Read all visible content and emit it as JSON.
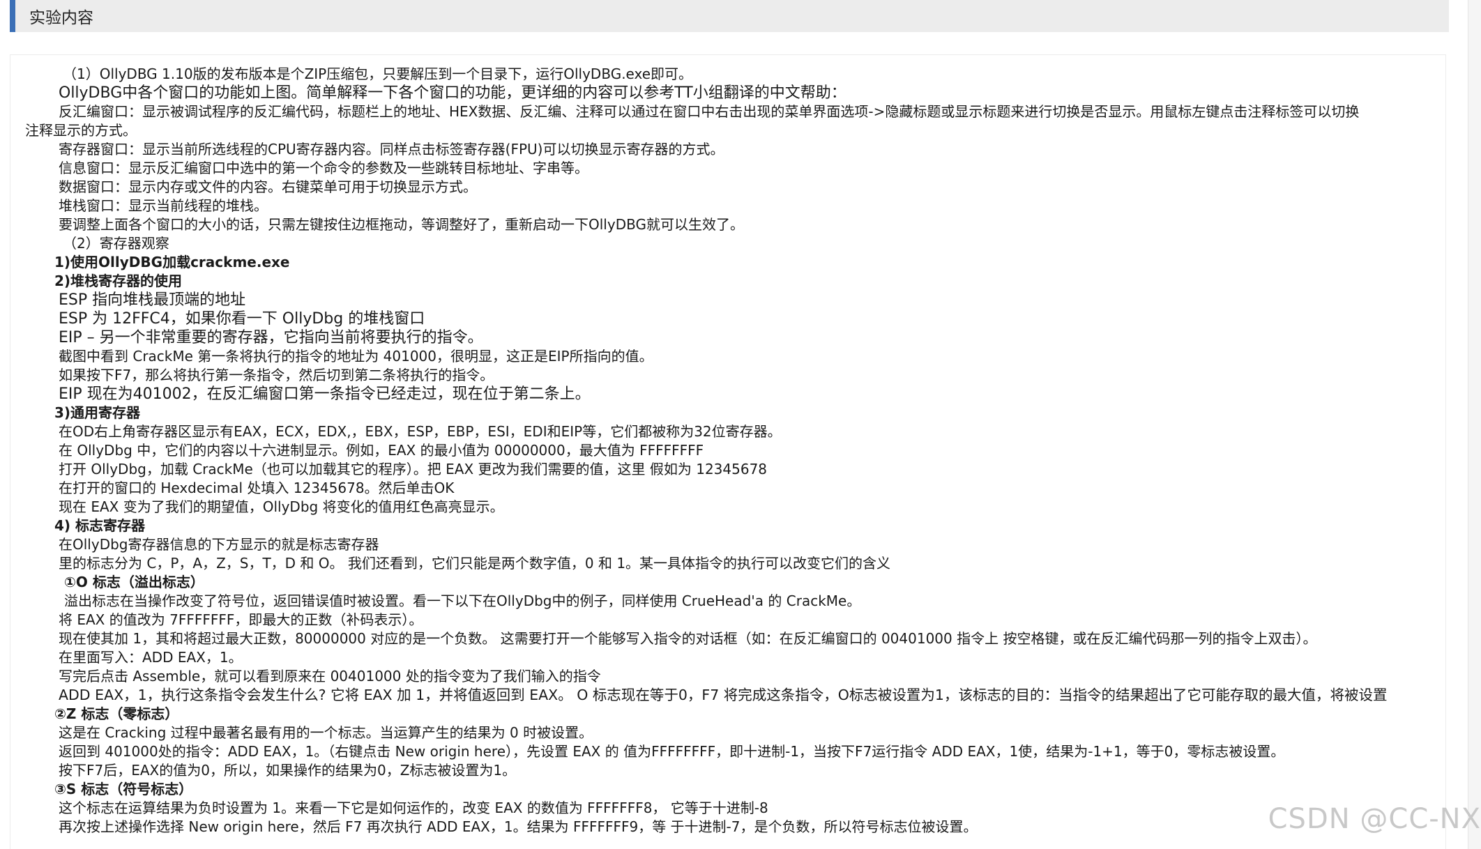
{
  "header": {
    "title": "实验内容"
  },
  "lines": [
    "（1）OllyDBG 1.10版的发布版本是个ZIP压缩包，只要解压到一个目录下，运行OllyDBG.exe即可。",
    "OllyDBG中各个窗口的功能如上图。简单解释一下各个窗口的功能，更详细的内容可以参考TT小组翻译的中文帮助：",
    "反汇编窗口：显示被调试程序的反汇编代码，标题栏上的地址、HEX数据、反汇编、注释可以通过在窗口中右击出现的菜单界面选项->隐藏标题或显示标题来进行切换是否显示。用鼠标左键点击注释标签可以切换",
    "注释显示的方式。",
    "寄存器窗口：显示当前所选线程的CPU寄存器内容。同样点击标签寄存器(FPU)可以切换显示寄存器的方式。",
    "信息窗口：显示反汇编窗口中选中的第一个命令的参数及一些跳转目标地址、字串等。",
    "数据窗口：显示内存或文件的内容。右键菜单可用于切换显示方式。",
    "堆栈窗口：显示当前线程的堆栈。",
    "要调整上面各个窗口的大小的话，只需左键按住边框拖动，等调整好了，重新启动一下OllyDBG就可以生效了。",
    "（2）寄存器观察",
    "1)使用OllyDBG加载crackme.exe",
    "2)堆栈寄存器的使用",
    "ESP 指向堆栈最顶端的地址",
    "ESP 为 12FFC4，如果你看一下 OllyDbg 的堆栈窗口",
    "EIP – 另一个非常重要的寄存器，它指向当前将要执行的指令。",
    "截图中看到 CrackMe 第一条将执行的指令的地址为 401000，很明显，这正是EIP所指向的值。",
    "如果按下F7，那么将执行第一条指令，然后切到第二条将执行的指令。",
    "EIP 现在为401002，在反汇编窗口第一条指令已经走过，现在位于第二条上。",
    "3)通用寄存器",
    "在OD右上角寄存器区显示有EAX，ECX，EDX,，EBX，ESP，EBP，ESI，EDI和EIP等，它们都被称为32位寄存器。",
    "在 OllyDbg 中，它们的内容以十六进制显示。例如，EAX 的最小值为 00000000，最大值为 FFFFFFFF",
    "打开 OllyDbg，加载 CrackMe（也可以加载其它的程序）。把 EAX 更改为我们需要的值，这里 假如为 12345678",
    "在打开的窗口的 Hexdecimal 处填入 12345678。然后单击OK",
    "现在 EAX 变为了我们的期望值，OllyDbg 将变化的值用红色高亮显示。",
    "4) 标志寄存器",
    "在OllyDbg寄存器信息的下方显示的就是标志寄存器",
    "里的标志分为 C，P，A，Z，S，T，D 和 O。 我们还看到，它们只能是两个数字值，0 和 1。某一具体指令的执行可以改变它们的含义",
    "①O 标志（溢出标志）",
    "溢出标志在当操作改变了符号位，返回错误值时被设置。看一下以下在OllyDbg中的例子，同样使用 CrueHead'a 的 CrackMe。",
    "将 EAX 的值改为 7FFFFFFF，即最大的正数（补码表示）。",
    "现在使其加 1，其和将超过最大正数，80000000 对应的是一个负数。 这需要打开一个能够写入指令的对话框（如：在反汇编窗口的 00401000 指令上 按空格键，或在反汇编代码那一列的指令上双击）。",
    "在里面写入：ADD EAX，1。",
    "写完后点击 Assemble，就可以看到原来在 00401000 处的指令变为了我们输入的指令",
    "ADD EAX，1，执行这条指令会发生什么? 它将 EAX 加 1，并将值返回到 EAX。 O 标志现在等于0，F7 将完成这条指令，O标志被设置为1，该标志的目的：当指令的结果超出了它可能存取的最大值，将被设置",
    "②Z 标志（零标志）",
    "这是在 Cracking 过程中最著名最有用的一个标志。当运算产生的结果为 0 时被设置。",
    "返回到 401000处的指令：ADD EAX，1。（右键点击 New origin here），先设置 EAX 的 值为FFFFFFFF，即十进制-1，当按下F7运行指令 ADD EAX，1使，结果为-1+1，等于0，零标志被设置。",
    "按下F7后，EAX的值为0，所以，如果操作的结果为0，Z标志被设置为1。",
    "③S 标志（符号标志）",
    "这个标志在运算结果为负时设置为 1。来看一下它是如何运作的，改变 EAX 的数值为 FFFFFFF8， 它等于十进制-8",
    "再次按上述操作选择 New origin here，然后 F7 再次执行 ADD EAX，1。结果为 FFFFFFF9，等 于十进制-7，是个负数，所以符号标志位被设置。"
  ],
  "watermark": "CSDN @CC-NX"
}
